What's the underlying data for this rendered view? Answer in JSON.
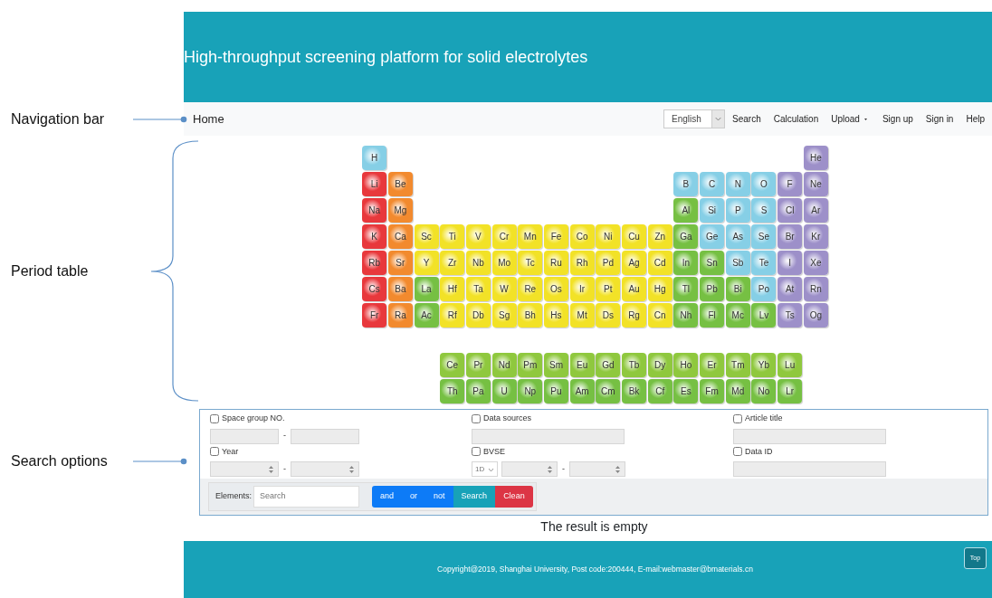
{
  "header": {
    "title": "High-throughput screening platform for solid electrolytes"
  },
  "navbar": {
    "brand": "Home",
    "language": "English",
    "links": [
      {
        "label": "Search",
        "has_caret": false
      },
      {
        "label": "Calculation",
        "has_caret": false
      },
      {
        "label": "Upload",
        "has_caret": true
      },
      {
        "label": "Sign up",
        "has_caret": false
      },
      {
        "label": "Sign in",
        "has_caret": false
      },
      {
        "label": "Help",
        "has_caret": false
      }
    ]
  },
  "annotations": [
    {
      "label": "Navigation bar",
      "kind": "arrow"
    },
    {
      "label": "Period table",
      "kind": "brace"
    },
    {
      "label": "Search options",
      "kind": "arrow"
    }
  ],
  "periodic_table": {
    "rows": [
      [
        {
          "symbol": "H",
          "color": "#86cfe6"
        },
        "",
        "",
        "",
        "",
        "",
        "",
        "",
        "",
        "",
        "",
        "",
        "",
        "",
        "",
        "",
        "",
        {
          "symbol": "He",
          "color": "#9d90c9"
        }
      ],
      [
        {
          "symbol": "Li",
          "color": "#e8383c"
        },
        {
          "symbol": "Be",
          "color": "#f28a2e"
        },
        "",
        "",
        "",
        "",
        "",
        "",
        "",
        "",
        "",
        "",
        {
          "symbol": "B",
          "color": "#86cfe6"
        },
        {
          "symbol": "C",
          "color": "#86cfe6"
        },
        {
          "symbol": "N",
          "color": "#86cfe6"
        },
        {
          "symbol": "O",
          "color": "#86cfe6"
        },
        {
          "symbol": "F",
          "color": "#9d90c9"
        },
        {
          "symbol": "Ne",
          "color": "#9d90c9"
        }
      ],
      [
        {
          "symbol": "Na",
          "color": "#e8383c"
        },
        {
          "symbol": "Mg",
          "color": "#f28a2e"
        },
        "",
        "",
        "",
        "",
        "",
        "",
        "",
        "",
        "",
        "",
        {
          "symbol": "Al",
          "color": "#76c043"
        },
        {
          "symbol": "Si",
          "color": "#86cfe6"
        },
        {
          "symbol": "P",
          "color": "#86cfe6"
        },
        {
          "symbol": "S",
          "color": "#86cfe6"
        },
        {
          "symbol": "Cl",
          "color": "#9d90c9"
        },
        {
          "symbol": "Ar",
          "color": "#9d90c9"
        }
      ],
      [
        {
          "symbol": "K",
          "color": "#e8383c"
        },
        {
          "symbol": "Ca",
          "color": "#f28a2e"
        },
        {
          "symbol": "Sc",
          "color": "#f2e227"
        },
        {
          "symbol": "Ti",
          "color": "#f2e227"
        },
        {
          "symbol": "V",
          "color": "#f2e227"
        },
        {
          "symbol": "Cr",
          "color": "#f2e227"
        },
        {
          "symbol": "Mn",
          "color": "#f2e227"
        },
        {
          "symbol": "Fe",
          "color": "#f2e227"
        },
        {
          "symbol": "Co",
          "color": "#f2e227"
        },
        {
          "symbol": "Ni",
          "color": "#f2e227"
        },
        {
          "symbol": "Cu",
          "color": "#f2e227"
        },
        {
          "symbol": "Zn",
          "color": "#f2e227"
        },
        {
          "symbol": "Ga",
          "color": "#76c043"
        },
        {
          "symbol": "Ge",
          "color": "#86cfe6"
        },
        {
          "symbol": "As",
          "color": "#86cfe6"
        },
        {
          "symbol": "Se",
          "color": "#86cfe6"
        },
        {
          "symbol": "Br",
          "color": "#9d90c9"
        },
        {
          "symbol": "Kr",
          "color": "#9d90c9"
        }
      ],
      [
        {
          "symbol": "Rb",
          "color": "#e8383c"
        },
        {
          "symbol": "Sr",
          "color": "#f28a2e"
        },
        {
          "symbol": "Y",
          "color": "#f2e227"
        },
        {
          "symbol": "Zr",
          "color": "#f2e227"
        },
        {
          "symbol": "Nb",
          "color": "#f2e227"
        },
        {
          "symbol": "Mo",
          "color": "#f2e227"
        },
        {
          "symbol": "Tc",
          "color": "#f2e227"
        },
        {
          "symbol": "Ru",
          "color": "#f2e227"
        },
        {
          "symbol": "Rh",
          "color": "#f2e227"
        },
        {
          "symbol": "Pd",
          "color": "#f2e227"
        },
        {
          "symbol": "Ag",
          "color": "#f2e227"
        },
        {
          "symbol": "Cd",
          "color": "#f2e227"
        },
        {
          "symbol": "In",
          "color": "#76c043"
        },
        {
          "symbol": "Sn",
          "color": "#76c043"
        },
        {
          "symbol": "Sb",
          "color": "#86cfe6"
        },
        {
          "symbol": "Te",
          "color": "#86cfe6"
        },
        {
          "symbol": "I",
          "color": "#9d90c9"
        },
        {
          "symbol": "Xe",
          "color": "#9d90c9"
        }
      ],
      [
        {
          "symbol": "Cs",
          "color": "#e8383c"
        },
        {
          "symbol": "Ba",
          "color": "#f28a2e"
        },
        {
          "symbol": "La",
          "color": "#76c043"
        },
        {
          "symbol": "Hf",
          "color": "#f2e227"
        },
        {
          "symbol": "Ta",
          "color": "#f2e227"
        },
        {
          "symbol": "W",
          "color": "#f2e227"
        },
        {
          "symbol": "Re",
          "color": "#f2e227"
        },
        {
          "symbol": "Os",
          "color": "#f2e227"
        },
        {
          "symbol": "Ir",
          "color": "#f2e227"
        },
        {
          "symbol": "Pt",
          "color": "#f2e227"
        },
        {
          "symbol": "Au",
          "color": "#f2e227"
        },
        {
          "symbol": "Hg",
          "color": "#f2e227"
        },
        {
          "symbol": "Tl",
          "color": "#76c043"
        },
        {
          "symbol": "Pb",
          "color": "#76c043"
        },
        {
          "symbol": "Bi",
          "color": "#76c043"
        },
        {
          "symbol": "Po",
          "color": "#86cfe6"
        },
        {
          "symbol": "At",
          "color": "#9d90c9"
        },
        {
          "symbol": "Rn",
          "color": "#9d90c9"
        }
      ],
      [
        {
          "symbol": "Fr",
          "color": "#e8383c"
        },
        {
          "symbol": "Ra",
          "color": "#f28a2e"
        },
        {
          "symbol": "Ac",
          "color": "#76c043"
        },
        {
          "symbol": "Rf",
          "color": "#f2e227"
        },
        {
          "symbol": "Db",
          "color": "#f2e227"
        },
        {
          "symbol": "Sg",
          "color": "#f2e227"
        },
        {
          "symbol": "Bh",
          "color": "#f2e227"
        },
        {
          "symbol": "Hs",
          "color": "#f2e227"
        },
        {
          "symbol": "Mt",
          "color": "#f2e227"
        },
        {
          "symbol": "Ds",
          "color": "#f2e227"
        },
        {
          "symbol": "Rg",
          "color": "#f2e227"
        },
        {
          "symbol": "Cn",
          "color": "#f2e227"
        },
        {
          "symbol": "Nh",
          "color": "#76c043"
        },
        {
          "symbol": "Fl",
          "color": "#76c043"
        },
        {
          "symbol": "Mc",
          "color": "#76c043"
        },
        {
          "symbol": "Lv",
          "color": "#76c043"
        },
        {
          "symbol": "Ts",
          "color": "#9d90c9"
        },
        {
          "symbol": "Og",
          "color": "#9d90c9"
        }
      ]
    ],
    "f_block": [
      [
        {
          "symbol": "Ce",
          "color": "#8fc83e"
        },
        {
          "symbol": "Pr",
          "color": "#8fc83e"
        },
        {
          "symbol": "Nd",
          "color": "#8fc83e"
        },
        {
          "symbol": "Pm",
          "color": "#8fc83e"
        },
        {
          "symbol": "Sm",
          "color": "#8fc83e"
        },
        {
          "symbol": "Eu",
          "color": "#8fc83e"
        },
        {
          "symbol": "Gd",
          "color": "#8fc83e"
        },
        {
          "symbol": "Tb",
          "color": "#8fc83e"
        },
        {
          "symbol": "Dy",
          "color": "#8fc83e"
        },
        {
          "symbol": "Ho",
          "color": "#8fc83e"
        },
        {
          "symbol": "Er",
          "color": "#8fc83e"
        },
        {
          "symbol": "Tm",
          "color": "#8fc83e"
        },
        {
          "symbol": "Yb",
          "color": "#8fc83e"
        },
        {
          "symbol": "Lu",
          "color": "#8fc83e"
        }
      ],
      [
        {
          "symbol": "Th",
          "color": "#76c043"
        },
        {
          "symbol": "Pa",
          "color": "#76c043"
        },
        {
          "symbol": "U",
          "color": "#76c043"
        },
        {
          "symbol": "Np",
          "color": "#76c043"
        },
        {
          "symbol": "Pu",
          "color": "#76c043"
        },
        {
          "symbol": "Am",
          "color": "#76c043"
        },
        {
          "symbol": "Cm",
          "color": "#76c043"
        },
        {
          "symbol": "Bk",
          "color": "#76c043"
        },
        {
          "symbol": "Cf",
          "color": "#76c043"
        },
        {
          "symbol": "Es",
          "color": "#76c043"
        },
        {
          "symbol": "Fm",
          "color": "#76c043"
        },
        {
          "symbol": "Md",
          "color": "#76c043"
        },
        {
          "symbol": "No",
          "color": "#76c043"
        },
        {
          "symbol": "Lr",
          "color": "#76c043"
        }
      ]
    ]
  },
  "search_options": {
    "filters": [
      {
        "label": "Space group NO.",
        "checked": false,
        "kind": "text_range",
        "separator": "-"
      },
      {
        "label": "Data sources",
        "checked": false,
        "kind": "text"
      },
      {
        "label": "Article title",
        "checked": false,
        "kind": "text"
      },
      {
        "label": "Year",
        "checked": false,
        "kind": "number_range",
        "separator": "-"
      },
      {
        "label": "BVSE",
        "checked": false,
        "kind": "select_range",
        "select_value": "1D",
        "separator": "-"
      },
      {
        "label": "Data ID",
        "checked": false,
        "kind": "text"
      }
    ],
    "elements_label": "Elements:",
    "elements_placeholder": "Search",
    "buttons": [
      {
        "label": "and",
        "kind": "primary"
      },
      {
        "label": "or",
        "kind": "primary"
      },
      {
        "label": "not",
        "kind": "primary"
      },
      {
        "label": "Search",
        "kind": "info"
      },
      {
        "label": "Clean",
        "kind": "danger"
      }
    ]
  },
  "result": "The result is empty",
  "footer": {
    "text": "Copyright@2019, Shanghai University, Post code:200444, E-mail:webmaster@bmaterials.cn",
    "top_button": "Top"
  }
}
